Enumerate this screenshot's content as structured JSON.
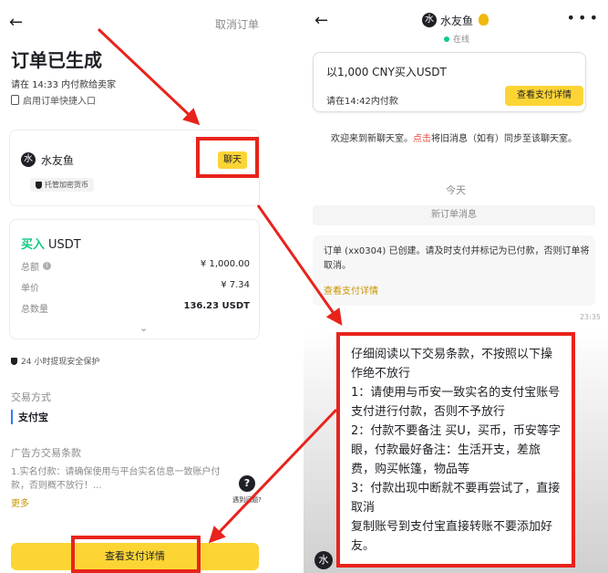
{
  "left": {
    "back_icon": "back-arrow-icon",
    "cancel_order": "取消订单",
    "title": "订单已生成",
    "pay_deadline": "请在 14:33 内付款给卖家",
    "quick_entry": "启用订单快捷入口",
    "merchant": {
      "avatar_glyph": "水",
      "name": "水友鱼",
      "badge": "托管加密货币",
      "chat_button": "聊天"
    },
    "order": {
      "side": "买入",
      "asset": "USDT",
      "rows": [
        {
          "label": "总额",
          "value": "¥ 1,000.00"
        },
        {
          "label": "单价",
          "value": "¥ 7.34"
        },
        {
          "label": "总数量",
          "value": "136.23 USDT"
        }
      ],
      "expand_glyph": "⌄"
    },
    "protection": "24 小时提现安全保护",
    "trade_method_label": "交易方式",
    "trade_method": "支付宝",
    "terms_label": "广告方交易条款",
    "terms_text": "1.实名付款：请确保使用与平台实名信息一致账户付款，否则概不放行！...",
    "more": "更多",
    "help_label": "遇到问题?",
    "view_payment_button": "查看支付详情"
  },
  "right": {
    "back_icon": "back-arrow-icon",
    "avatar_glyph": "水",
    "name": "水友鱼",
    "status": "在线",
    "order_box": {
      "title": "以1,000 CNY买入USDT",
      "deadline": "请在14:42内付款",
      "button": "查看支付详情"
    },
    "welcome_pre": "欢迎来到新聊天室。",
    "welcome_link": "点击",
    "welcome_post": "将旧消息（如有）同步至该聊天室。",
    "today": "今天",
    "new_order_label": "新订单消息",
    "system_message": "订单 (xx0304) 已创建。请及时支付并标记为已付款，否则订单将取消。",
    "system_link": "查看支付详情",
    "time": "23:35",
    "bottom_avatar_glyph": "水",
    "warning_lines": [
      "仔细阅读以下交易条款，不按照以下操作绝不放行",
      "1：请使用与币安一致实名的支付宝账号支付进行付款，否则不予放行",
      "2：付款不要备注 买U，买币，币安等字眼，付款最好备注：生活开支，差旅费，购买帐篷，物品等",
      "3：付款出现中断就不要再尝试了，直接取消",
      "复制账号到支付宝直接转账不要添加好友。"
    ]
  },
  "colors": {
    "accent_yellow": "#fcd535",
    "highlight_red": "#e8231c",
    "buy_green": "#0ecb81"
  }
}
